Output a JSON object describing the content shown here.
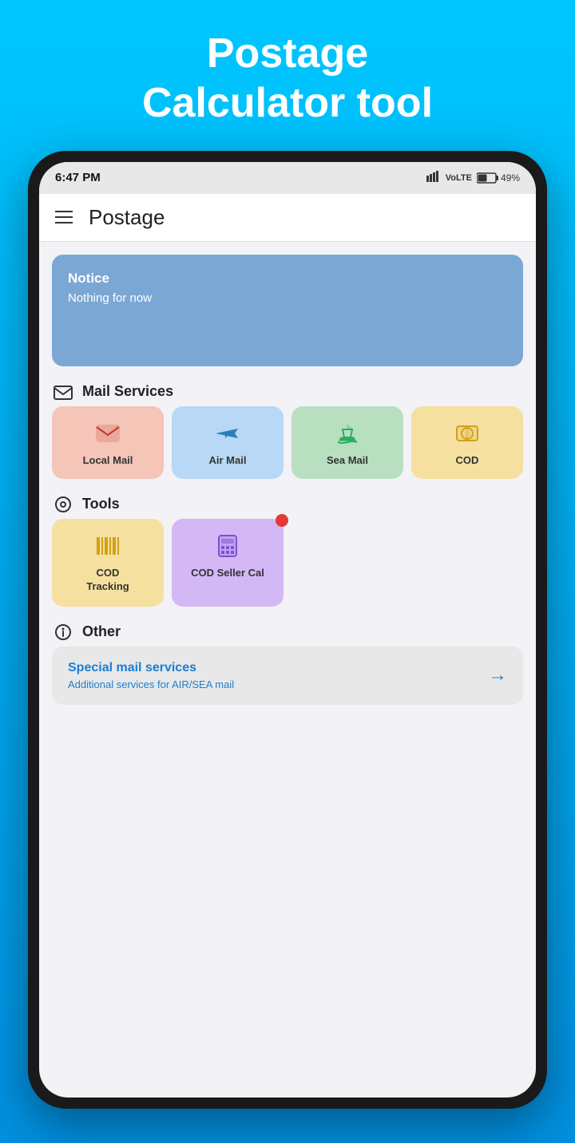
{
  "hero": {
    "title_line1": "Postage",
    "title_line2": "Calculator tool"
  },
  "status_bar": {
    "time": "6:47 PM",
    "signal": "▐▐▐▐",
    "battery": "49%"
  },
  "header": {
    "title": "Postage"
  },
  "notice": {
    "title": "Notice",
    "body": "Nothing for now"
  },
  "sections": {
    "mail_services": {
      "title": "Mail Services",
      "items": [
        {
          "id": "local-mail",
          "label": "Local Mail",
          "color": "local"
        },
        {
          "id": "air-mail",
          "label": "Air Mail",
          "color": "air"
        },
        {
          "id": "sea-mail",
          "label": "Sea Mail",
          "color": "sea"
        },
        {
          "id": "cod",
          "label": "COD",
          "color": "cod"
        }
      ]
    },
    "tools": {
      "title": "Tools",
      "items": [
        {
          "id": "cod-tracking",
          "label": "COD\nTracking",
          "color": "cod-tracking",
          "notification": false
        },
        {
          "id": "cod-seller-cal",
          "label": "COD Seller Cal",
          "color": "cod-seller",
          "notification": true
        }
      ]
    },
    "other": {
      "title": "Other",
      "card": {
        "title": "Special mail services",
        "subtitle": "Additional services for AIR/SEA mail"
      }
    }
  }
}
